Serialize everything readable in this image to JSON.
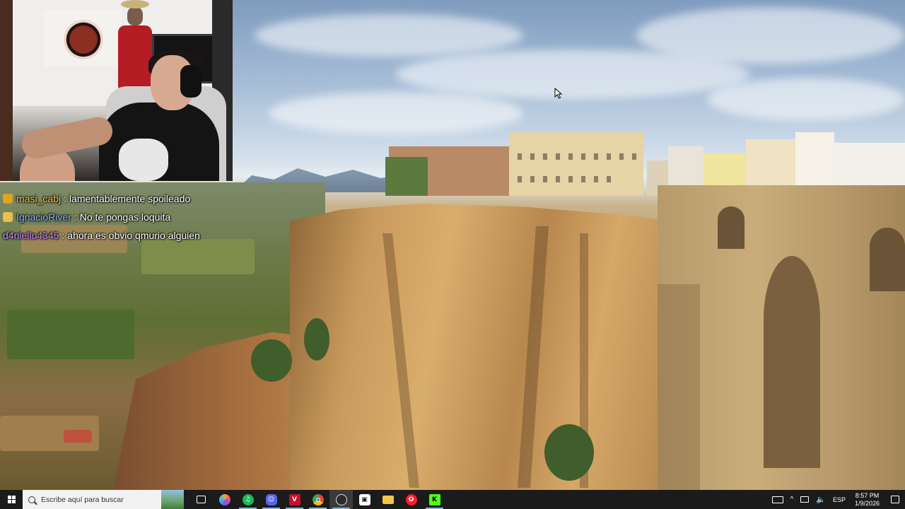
{
  "chat": {
    "messages": [
      {
        "user": "masi_cabj",
        "text": "lamentablemente spoileado",
        "user_color": "#f4c542",
        "badge_color": "#e0a31a",
        "badge_icon": "crown-icon"
      },
      {
        "user": "IgnacioRiver",
        "text": "No te pongas loquita",
        "user_color": "#8fb8ff",
        "badge_color": "#e8c04a",
        "badge_icon": "sub-badge-icon"
      },
      {
        "user": "d4niello4345",
        "text": "ahora es obvio qmurio alguien",
        "user_color": "#c98bff",
        "badge_color": null,
        "badge_icon": null
      }
    ]
  },
  "taskbar": {
    "search_placeholder": "Escribe aquí para buscar",
    "apps": [
      {
        "name": "task-view-icon",
        "color": "#1b1b1b",
        "glyph": "⧉",
        "active": false
      },
      {
        "name": "copilot-icon",
        "color": "#6a5cff",
        "glyph": "◉",
        "active": false
      },
      {
        "name": "spotify-icon",
        "color": "#1db954",
        "glyph": "♫",
        "active": true
      },
      {
        "name": "discord-icon",
        "color": "#5865f2",
        "glyph": "☺",
        "active": true
      },
      {
        "name": "voicemeeter-icon",
        "color": "#c8102e",
        "glyph": "V",
        "active": true
      },
      {
        "name": "chrome-icon",
        "color": "#2e9e4f",
        "glyph": "◎",
        "active": true
      },
      {
        "name": "obs-icon",
        "color": "#2b2b2b",
        "glyph": "●",
        "active": true,
        "selected": true
      },
      {
        "name": "streamlabs-icon",
        "color": "#31c3a2",
        "glyph": "▣",
        "active": false
      },
      {
        "name": "file-explorer-icon",
        "color": "#f2c744",
        "glyph": "▭",
        "active": false
      },
      {
        "name": "opera-icon",
        "color": "#ff1b2d",
        "glyph": "O",
        "active": false
      },
      {
        "name": "kick-icon",
        "color": "#53fc18",
        "glyph": "K",
        "active": true
      }
    ],
    "tray": {
      "language": "ESP",
      "time": "8:57 PM",
      "date": "1/9/2026"
    }
  }
}
